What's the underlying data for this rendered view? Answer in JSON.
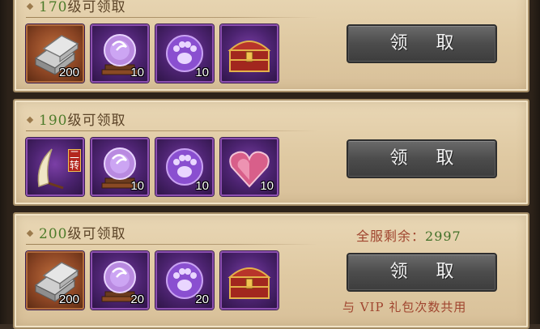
{
  "tiers": [
    {
      "level": "170",
      "suffix": "级可领取",
      "claim_label": "领 取",
      "items": [
        {
          "icon": "silver-ingot-icon",
          "count": "200",
          "rarity": "orange"
        },
        {
          "icon": "purple-crystal-ball-icon",
          "count": "10",
          "rarity": "purple"
        },
        {
          "icon": "purple-paw-orb-icon",
          "count": "10",
          "rarity": "purple"
        },
        {
          "icon": "treasure-chest-icon",
          "count": "",
          "rarity": "purple"
        }
      ]
    },
    {
      "level": "190",
      "suffix": "级可领取",
      "claim_label": "领 取",
      "items": [
        {
          "icon": "feather-fan-weapon-icon",
          "count": "",
          "badge": "二转",
          "rarity": "purple"
        },
        {
          "icon": "purple-crystal-ball-icon",
          "count": "10",
          "rarity": "purple"
        },
        {
          "icon": "purple-paw-orb-icon",
          "count": "10",
          "rarity": "purple"
        },
        {
          "icon": "heart-box-icon",
          "count": "10",
          "rarity": "purple"
        }
      ]
    },
    {
      "level": "200",
      "suffix": "级可领取",
      "claim_label": "领 取",
      "remain_label": "全服剩余：",
      "remain_count": "2997",
      "note": "与 VIP 礼包次数共用",
      "items": [
        {
          "icon": "silver-ingot-icon",
          "count": "200",
          "rarity": "orange"
        },
        {
          "icon": "purple-crystal-ball-icon",
          "count": "20",
          "rarity": "purple"
        },
        {
          "icon": "purple-paw-orb-icon",
          "count": "20",
          "rarity": "purple"
        },
        {
          "icon": "treasure-chest-icon",
          "count": "",
          "rarity": "purple"
        }
      ]
    }
  ],
  "colors": {
    "level_green": "#4d7b2a",
    "note_red": "#a0452f",
    "purple_frame": "#8c4fb0"
  }
}
